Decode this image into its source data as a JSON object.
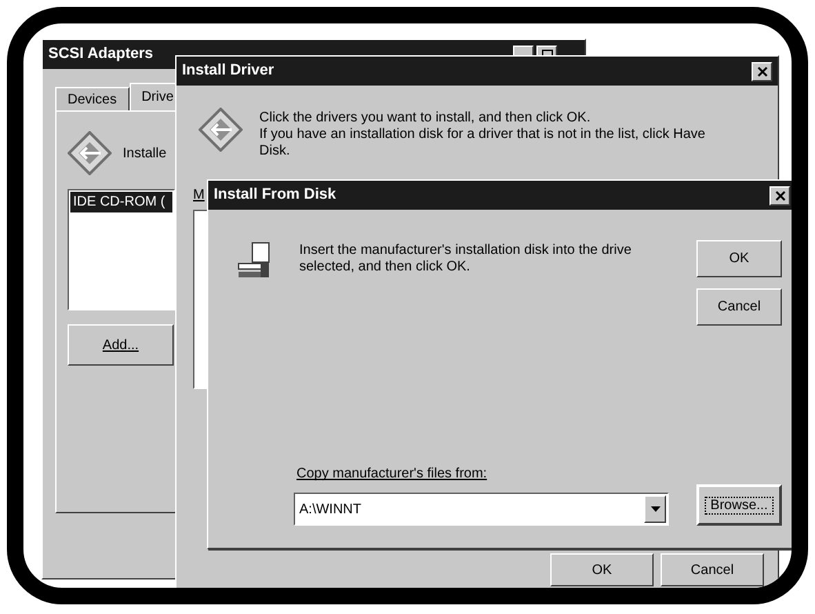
{
  "scsi_adapters": {
    "title": "SCSI Adapters",
    "tabs": [
      {
        "label": "Devices",
        "selected": false
      },
      {
        "label": "Drive",
        "selected": true
      }
    ],
    "heading": "Installe",
    "list_items": [
      {
        "label": "IDE CD-ROM (",
        "selected": true
      }
    ],
    "add_button": "Add..."
  },
  "install_driver": {
    "title": "Install Driver",
    "message_lines": [
      "Click the drivers you want to install, and then click OK.",
      "If you have an installation disk for a driver that is not in the list, click Have",
      "Disk."
    ],
    "list_label": "M",
    "buttons": [
      "OK",
      "Cancel"
    ]
  },
  "install_from_disk": {
    "title": "Install From Disk",
    "message": "Insert the manufacturer's installation disk into the drive selected, and then click OK.",
    "buttons": [
      "OK",
      "Cancel"
    ],
    "copy_label": "Copy manufacturer's files from:",
    "path_value": "A:\\WINNT",
    "browse_button": "Browse..."
  }
}
